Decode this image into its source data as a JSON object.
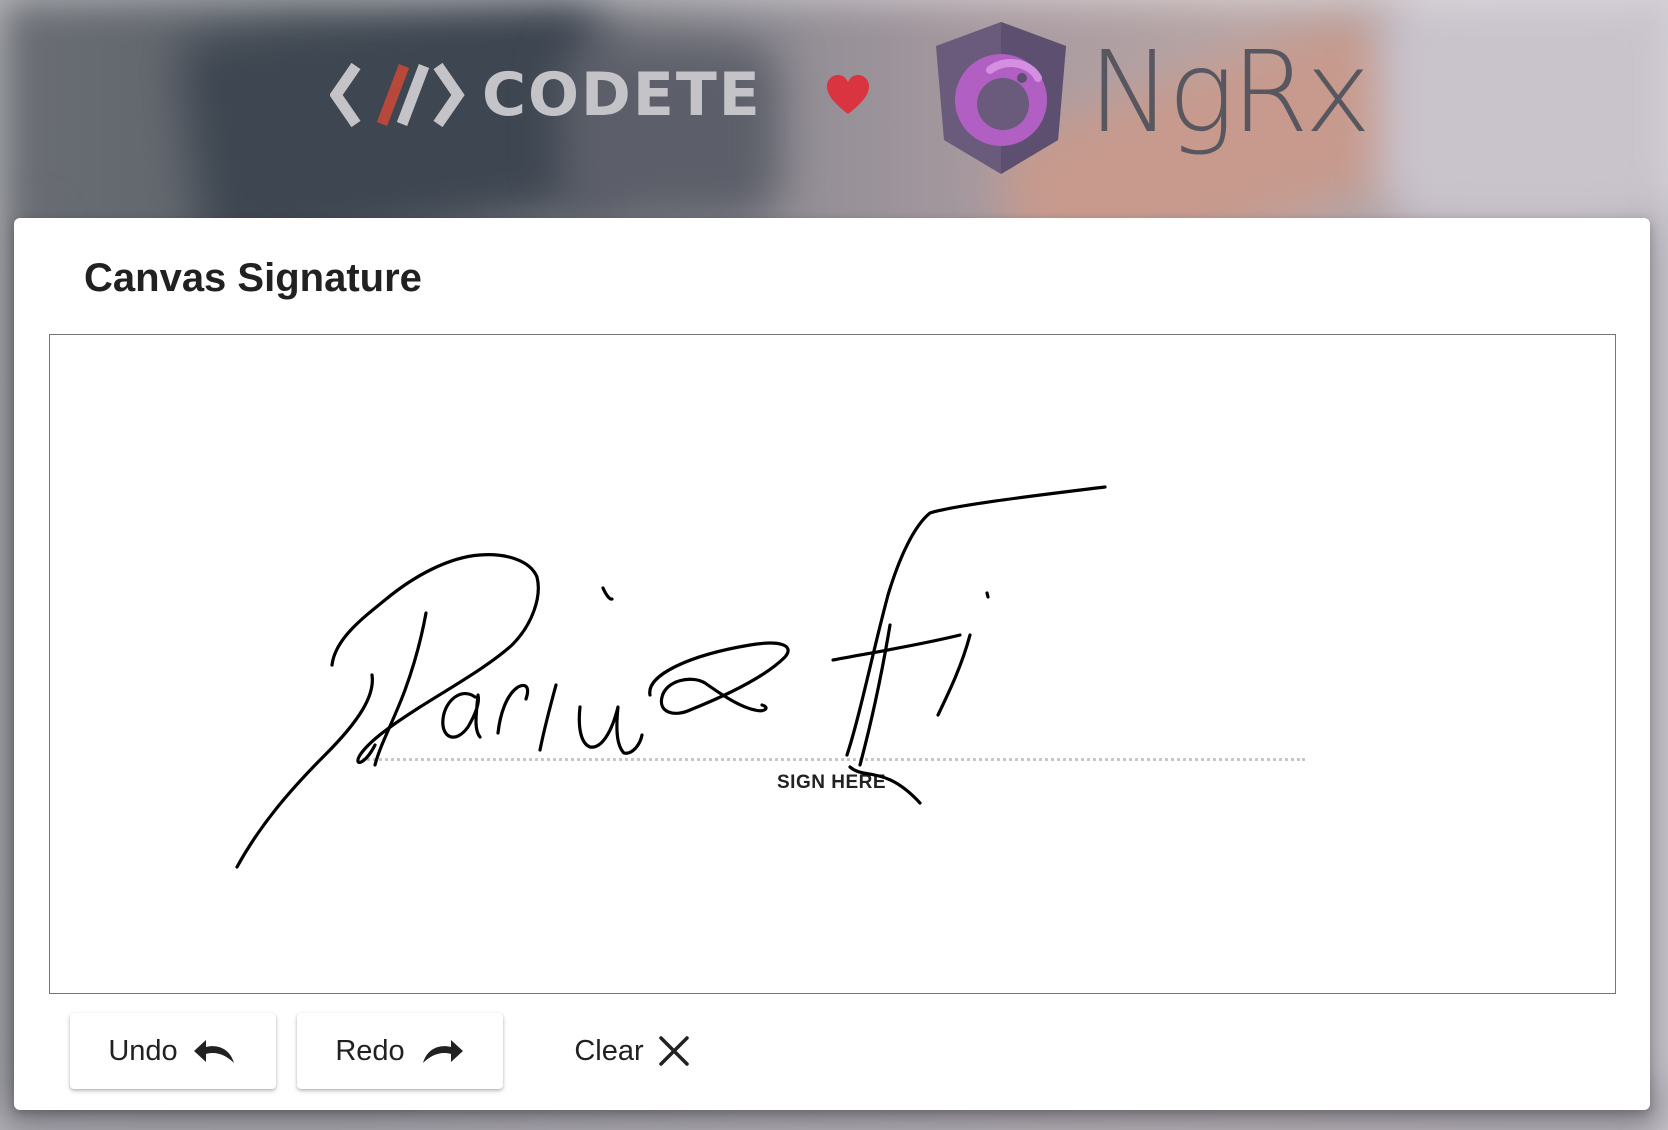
{
  "header": {
    "brand_left": "CODETE",
    "brand_right": "NgRx",
    "heart_color": "#d9343f"
  },
  "card": {
    "title": "Canvas Signature",
    "canvas": {
      "sign_label": "SIGN HERE"
    }
  },
  "actions": {
    "undo_label": "Undo",
    "redo_label": "Redo",
    "clear_label": "Clear",
    "undo_icon": "undo-arrow",
    "redo_icon": "redo-arrow",
    "clear_icon": "close-x"
  },
  "colors": {
    "card_bg": "#ffffff",
    "canvas_border": "#757575",
    "ink": "#000000",
    "codete_accent": "#c0452f",
    "ngrx_purple": "#b25fc3"
  }
}
